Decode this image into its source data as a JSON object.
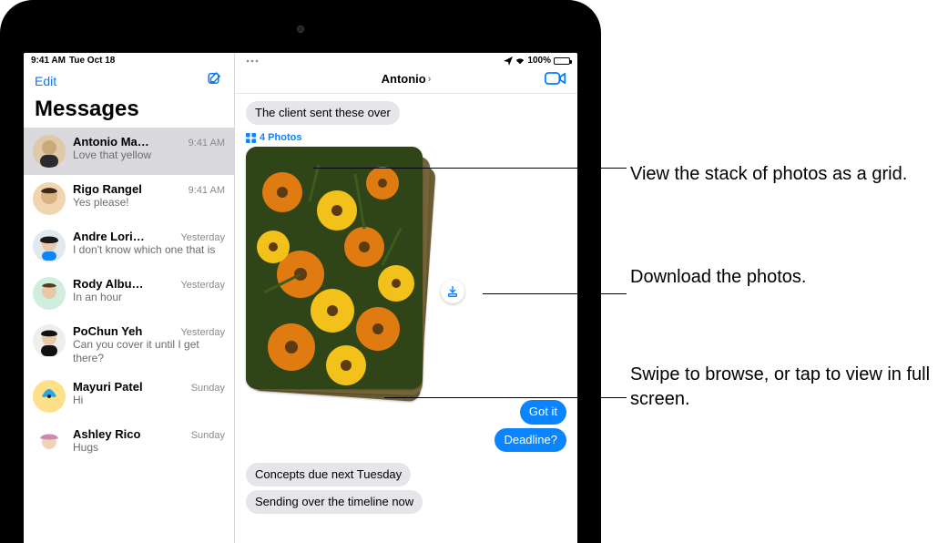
{
  "status": {
    "time": "9:41 AM",
    "date": "Tue Oct 18",
    "battery_pct": "100%"
  },
  "sidebar": {
    "edit": "Edit",
    "title": "Messages",
    "conversations": [
      {
        "name": "Antonio Ma…",
        "time": "9:41 AM",
        "preview": "Love that yellow",
        "avatar": "face-1"
      },
      {
        "name": "Rigo Rangel",
        "time": "9:41 AM",
        "preview": "Yes please!",
        "avatar": "face-2"
      },
      {
        "name": "Andre Lori…",
        "time": "Yesterday",
        "preview": "I don't know which one that is",
        "avatar": "face-3"
      },
      {
        "name": "Rody Albu…",
        "time": "Yesterday",
        "preview": "In an hour",
        "avatar": "face-4"
      },
      {
        "name": "PoChun Yeh",
        "time": "Yesterday",
        "preview": "Can you cover it until I get there?",
        "avatar": "face-5"
      },
      {
        "name": "Mayuri Patel",
        "time": "Sunday",
        "preview": "Hi",
        "avatar": "butterfly"
      },
      {
        "name": "Ashley Rico",
        "time": "Sunday",
        "preview": "Hugs",
        "avatar": "face-6"
      }
    ]
  },
  "thread": {
    "contact": "Antonio",
    "photos_label": "4 Photos",
    "messages_in_top": [
      "The client sent these over"
    ],
    "messages_out": [
      "Got it",
      "Deadline?"
    ],
    "messages_in_bottom": [
      "Concepts due next Tuesday",
      "Sending over the timeline now"
    ]
  },
  "callouts": {
    "grid": "View the stack of photos as a grid.",
    "download": "Download the photos.",
    "browse": "Swipe to browse, or tap to view in full screen."
  }
}
